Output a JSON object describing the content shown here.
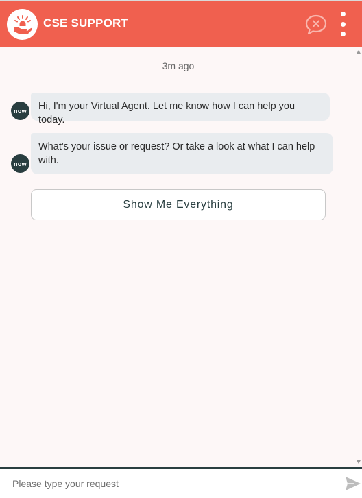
{
  "header": {
    "title": "CSE SUPPORT",
    "background_color": "#f0604f",
    "logo_icon": "hand-with-lightbulb-icon",
    "end_chat_icon": "chat-bubble-x-icon",
    "menu_icon": "vertical-ellipsis-icon"
  },
  "conversation": {
    "timestamp": "3m ago",
    "messages": [
      {
        "sender_avatar": "now",
        "text": "Hi, I'm your Virtual Agent. Let me know how I can help you today."
      },
      {
        "sender_avatar": "now",
        "text": "What's your issue or request? Or take a look at what I can help with."
      }
    ],
    "options": [
      {
        "label": "Show Me Everything"
      }
    ]
  },
  "input": {
    "placeholder": "Please type your request",
    "value": "",
    "send_icon": "send-arrow-icon"
  },
  "colors": {
    "accent": "#f0604f",
    "avatar_bg": "#293e40",
    "bubble_bg": "#e9ecef",
    "conversation_bg": "#fdf7f7"
  }
}
